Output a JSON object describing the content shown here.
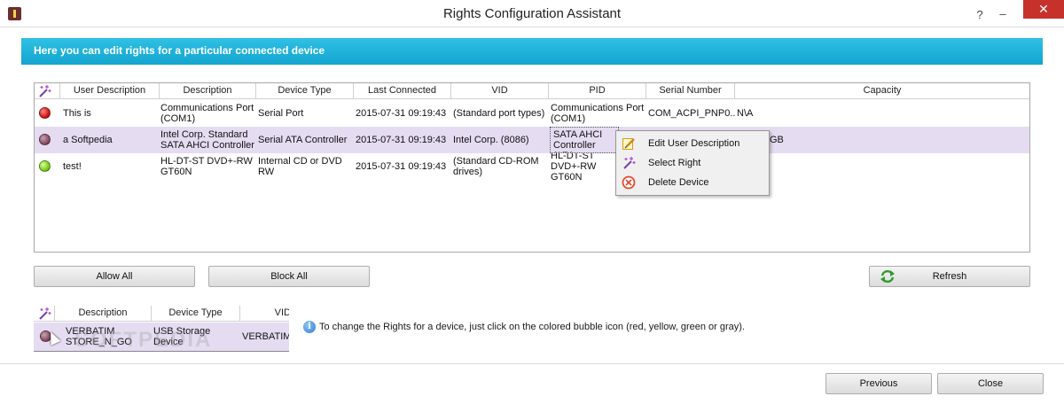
{
  "window": {
    "title": "Rights Configuration Assistant",
    "help": "?",
    "minimize": "–",
    "close": "✕"
  },
  "banner": {
    "text": "Here you can edit rights for a particular connected device"
  },
  "grid": {
    "headers": [
      "User Description",
      "Description",
      "Device Type",
      "Last Connected",
      "VID",
      "PID",
      "Serial Number",
      "Capacity"
    ],
    "rows": [
      {
        "status": "red",
        "user_description": "This is",
        "description": "Communications Port (COM1)",
        "device_type": "Serial Port",
        "last_connected": "2015-07-31 09:19:43",
        "vid": "(Standard port types)",
        "pid": "Communications Port (COM1)",
        "serial": "COM_ACPI_PNP0...",
        "capacity": "N\\A"
      },
      {
        "status": "gray",
        "user_description": "a Softpedia",
        "description": "Intel Corp. Standard SATA AHCI Controller",
        "device_type": "Serial ATA Controller",
        "last_connected": "2015-07-31 09:19:43",
        "vid": "Intel Corp. (8086)",
        "pid": "Standard SATA AHCI Controller (1E0",
        "serial": "",
        "capacity": "GB"
      },
      {
        "status": "green",
        "user_description": "test!",
        "description": "HL-DT-ST DVD+-RW GT60N",
        "device_type": "Internal CD or DVD RW",
        "last_connected": "2015-07-31 09:19:43",
        "vid": "(Standard CD-ROM drives)",
        "pid": "HL-DT-ST DVD+-RW GT60N",
        "serial": "",
        "capacity": ""
      }
    ]
  },
  "context_menu": {
    "items": [
      {
        "label": "Edit User Description",
        "icon": "edit-icon"
      },
      {
        "label": "Select Right",
        "icon": "wand-icon"
      },
      {
        "label": "Delete Device",
        "icon": "delete-icon"
      }
    ]
  },
  "buttons": {
    "allow_all": "Allow All",
    "block_all": "Block All",
    "refresh": "Refresh",
    "previous": "Previous",
    "close": "Close"
  },
  "usb_table": {
    "headers": [
      "Description",
      "Device Type",
      "VID"
    ],
    "row": {
      "status": "gray",
      "description": "VERBATIM STORE_N_GO",
      "device_type": "USB Storage Device",
      "vid": "VERBATIM"
    }
  },
  "info": {
    "text": "To change the Rights for a device, just click on the colored bubble icon (red, yellow, green or gray)."
  },
  "watermark": "SOFTPEDIA",
  "colors": {
    "banner": "#1aabd6",
    "selected_row": "#e5dcf2",
    "close_button": "#c7312b"
  }
}
